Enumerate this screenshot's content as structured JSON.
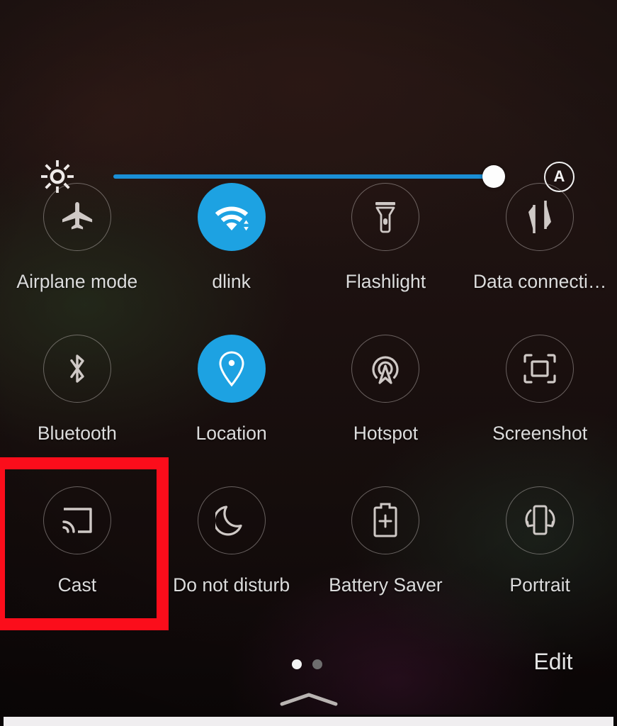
{
  "panel": {
    "name": "Android Quick Settings Panel",
    "background_color": "#1c1110",
    "accent_active_color": "#1da2e2",
    "label_color": "#dcdcdc",
    "highlight_color": "#fb0d1b"
  },
  "brightness": {
    "icon": "brightness-sun-icon",
    "value_percent": 95,
    "track_color": "#1a8fd6",
    "thumb_color": "#fdfdfd",
    "auto_label": "A",
    "auto_icon": "auto-brightness-icon"
  },
  "tiles": [
    {
      "id": "airplane-mode",
      "label": "Airplane mode",
      "icon": "airplane-icon",
      "active": false,
      "highlighted": false
    },
    {
      "id": "wifi",
      "label": "dlink",
      "icon": "wifi-icon",
      "active": true,
      "highlighted": false
    },
    {
      "id": "flashlight",
      "label": "Flashlight",
      "icon": "flashlight-icon",
      "active": false,
      "highlighted": false
    },
    {
      "id": "data-connection",
      "label": "Data connecti…",
      "icon": "data-transfer-arrows-icon",
      "active": false,
      "highlighted": false
    },
    {
      "id": "bluetooth",
      "label": "Bluetooth",
      "icon": "bluetooth-icon",
      "active": false,
      "highlighted": false
    },
    {
      "id": "location",
      "label": "Location",
      "icon": "location-pin-icon",
      "active": true,
      "highlighted": false
    },
    {
      "id": "hotspot",
      "label": "Hotspot",
      "icon": "hotspot-broadcast-icon",
      "active": false,
      "highlighted": false
    },
    {
      "id": "screenshot",
      "label": "Screenshot",
      "icon": "screenshot-crop-icon",
      "active": false,
      "highlighted": false
    },
    {
      "id": "cast",
      "label": "Cast",
      "icon": "cast-icon",
      "active": false,
      "highlighted": true
    },
    {
      "id": "do-not-disturb",
      "label": "Do not disturb",
      "icon": "moon-icon",
      "active": false,
      "highlighted": false
    },
    {
      "id": "battery-saver",
      "label": "Battery Saver",
      "icon": "battery-plus-icon",
      "active": false,
      "highlighted": false
    },
    {
      "id": "portrait",
      "label": "Portrait",
      "icon": "rotation-lock-icon",
      "active": false,
      "highlighted": false
    }
  ],
  "footer": {
    "edit_label": "Edit",
    "pages": 2,
    "active_page": 1,
    "collapse_icon": "chevron-up-icon"
  }
}
